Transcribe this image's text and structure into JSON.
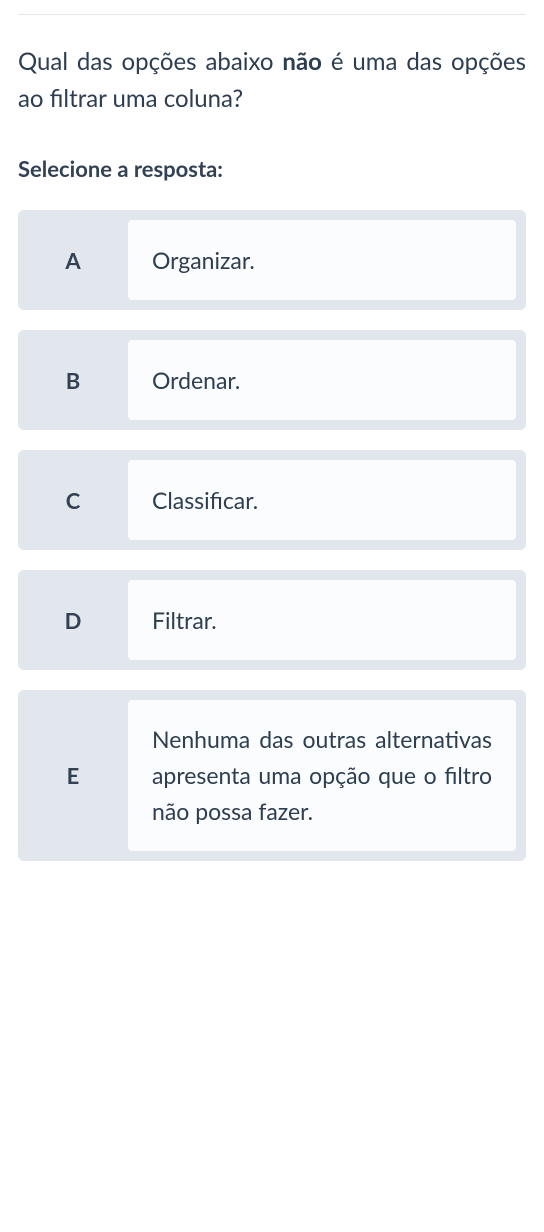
{
  "question": {
    "pre": "Qual das opções abaixo ",
    "bold": "não",
    "post": " é uma das opções ao filtrar uma coluna?"
  },
  "instruction": "Selecione a resposta:",
  "options": [
    {
      "letter": "A",
      "text": "Organizar.",
      "long": false
    },
    {
      "letter": "B",
      "text": "Ordenar.",
      "long": false
    },
    {
      "letter": "C",
      "text": "Classificar.",
      "long": false
    },
    {
      "letter": "D",
      "text": "Filtrar.",
      "long": false
    },
    {
      "letter": "E",
      "text": "Nenhuma das outras alternativas apresenta uma opção que o filtro não possa fazer.",
      "long": true
    }
  ]
}
